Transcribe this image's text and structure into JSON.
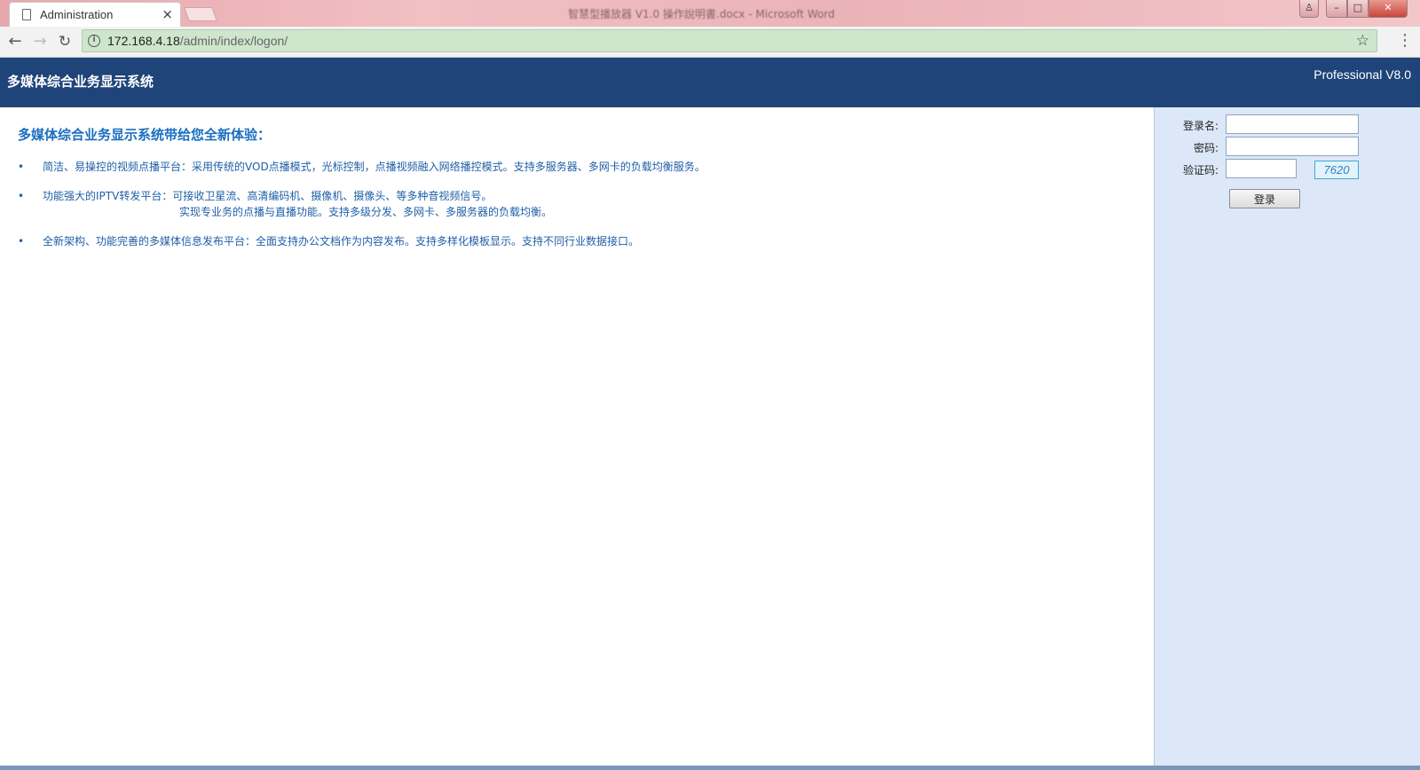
{
  "browser": {
    "tab_title": "Administration",
    "tab_close": "×",
    "window_title": "智慧型播放器 V1.0 操作說明書.docx - Microsoft Word",
    "url_host": "172.168.4.18",
    "url_path": "/admin/index/logon/",
    "back": "←",
    "forward": "→",
    "reload": "↻",
    "star": "☆",
    "menu": "⋮",
    "min": "–",
    "max": "□",
    "close": "✕",
    "user": "♙"
  },
  "header": {
    "title": "多媒体综合业务显示系统",
    "version": "Professional V8.0",
    "bg_color": "#1f4479"
  },
  "main": {
    "headline": "多媒体综合业务显示系统带给您全新体验：",
    "bullet": "•",
    "features": [
      {
        "line1": "简洁、易操控的视频点播平台：采用传统的VOD点播模式，光标控制，点播视频融入网络播控模式。支持多服务器、多网卡的负载均衡服务。",
        "line2": ""
      },
      {
        "line1": "功能强大的IPTV转发平台：可接收卫星流、高清编码机、摄像机、摄像头、等多种音视频信号。",
        "line2": "实现专业务的点播与直播功能。支持多级分发、多网卡、多服务器的负载均衡。"
      },
      {
        "line1": "全新架构、功能完善的多媒体信息发布平台：全面支持办公文档作为内容发布。支持多样化模板显示。支持不同行业数据接口。",
        "line2": ""
      }
    ]
  },
  "login": {
    "username_label": "登录名:",
    "password_label": "密码:",
    "captcha_label": "验证码:",
    "username_value": "",
    "password_value": "",
    "captcha_value": "",
    "captcha_code": "7620",
    "submit_label": "登录"
  }
}
